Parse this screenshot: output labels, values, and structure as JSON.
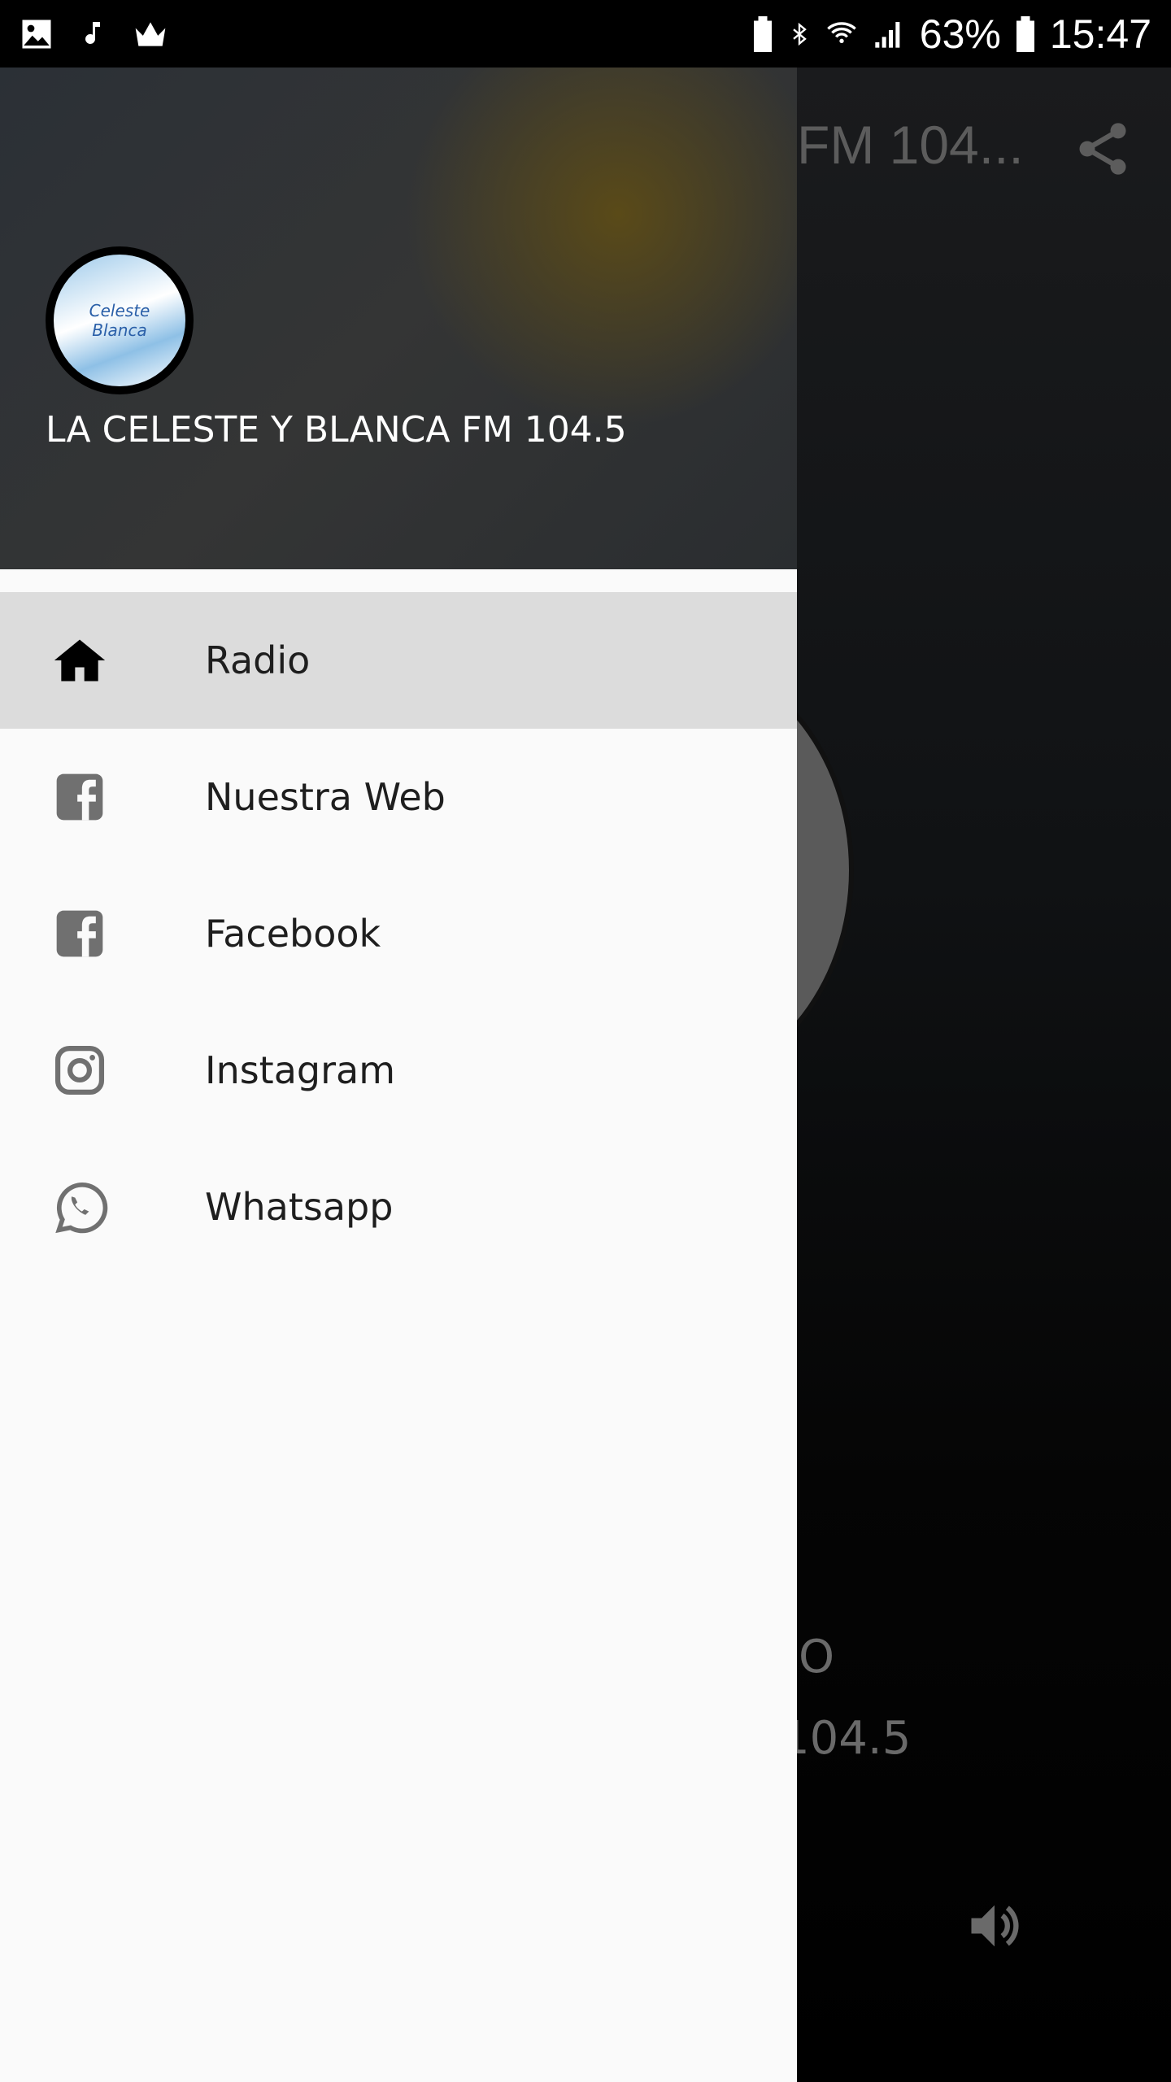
{
  "status_bar": {
    "battery": "63%",
    "time": "15:47",
    "left_icons": [
      "image-icon",
      "music-note-icon",
      "crown-icon"
    ],
    "right_icons": [
      "battery-saver-icon",
      "bluetooth-icon",
      "wifi-icon",
      "signal-icon",
      "battery-icon"
    ]
  },
  "app": {
    "toolbar_title": "FM 104...",
    "now_playing_line1": "O",
    "now_playing_line2": "104.5"
  },
  "drawer": {
    "header_title": "LA CELESTE Y BLANCA FM 104.5",
    "logo_text": "La Celeste y Blanca FM 104.5",
    "items": [
      {
        "label": "Radio",
        "icon": "home-icon",
        "active": true
      },
      {
        "label": "Nuestra Web",
        "icon": "facebook-icon"
      },
      {
        "label": "Facebook",
        "icon": "facebook-icon"
      },
      {
        "label": "Instagram",
        "icon": "instagram-icon"
      },
      {
        "label": "Whatsapp",
        "icon": "whatsapp-icon"
      }
    ]
  },
  "colors": {
    "active_item": "#dcdcdc",
    "drawer_bg": "#fafafa",
    "icon_gray": "#707070"
  }
}
